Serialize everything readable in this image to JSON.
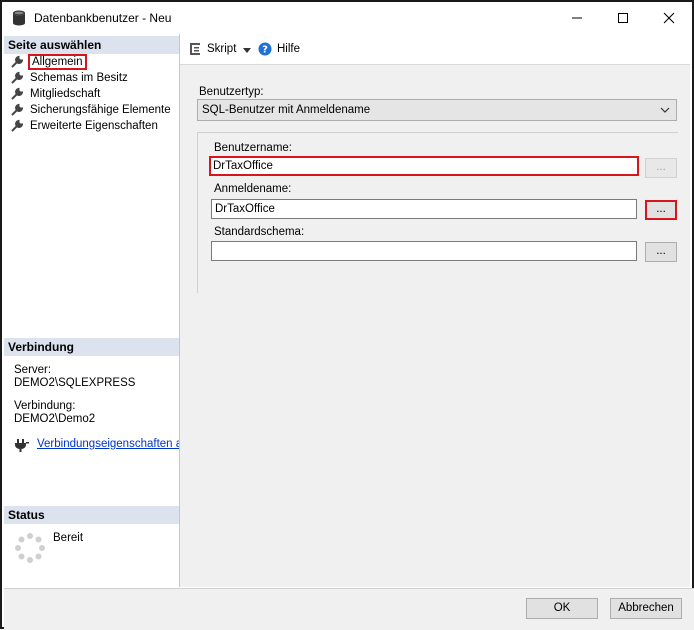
{
  "window": {
    "title": "Datenbankbenutzer - Neu"
  },
  "left_pane": {
    "select_page_header": "Seite auswählen",
    "pages": [
      {
        "label": "Allgemein",
        "selected": true
      },
      {
        "label": "Schemas im Besitz",
        "selected": false
      },
      {
        "label": "Mitgliedschaft",
        "selected": false
      },
      {
        "label": "Sicherungsfähige Elemente",
        "selected": false
      },
      {
        "label": "Erweiterte Eigenschaften",
        "selected": false
      }
    ],
    "connection": {
      "header": "Verbindung",
      "server_label": "Server:",
      "server_value": "DEMO2\\SQLEXPRESS",
      "connection_label": "Verbindung:",
      "connection_value": "DEMO2\\Demo2",
      "properties_link": "Verbindungseigenschaften anzeigen"
    },
    "status": {
      "header": "Status",
      "value": "Bereit"
    }
  },
  "toolbar": {
    "script_label": "Skript",
    "help_label": "Hilfe"
  },
  "form": {
    "user_type_label": "Benutzertyp:",
    "user_type_value": "SQL-Benutzer mit Anmeldename",
    "username_label": "Benutzername:",
    "username_value": "DrTaxOffice",
    "username_browse": "...",
    "login_label": "Anmeldename:",
    "login_value": "DrTaxOffice",
    "login_browse": "...",
    "schema_label": "Standardschema:",
    "schema_value": "",
    "schema_browse": "..."
  },
  "buttons": {
    "ok": "OK",
    "cancel": "Abbrechen"
  },
  "colors": {
    "highlight": "#d8141c",
    "section_header_bg": "#dce3ee",
    "link": "#0033cc"
  }
}
